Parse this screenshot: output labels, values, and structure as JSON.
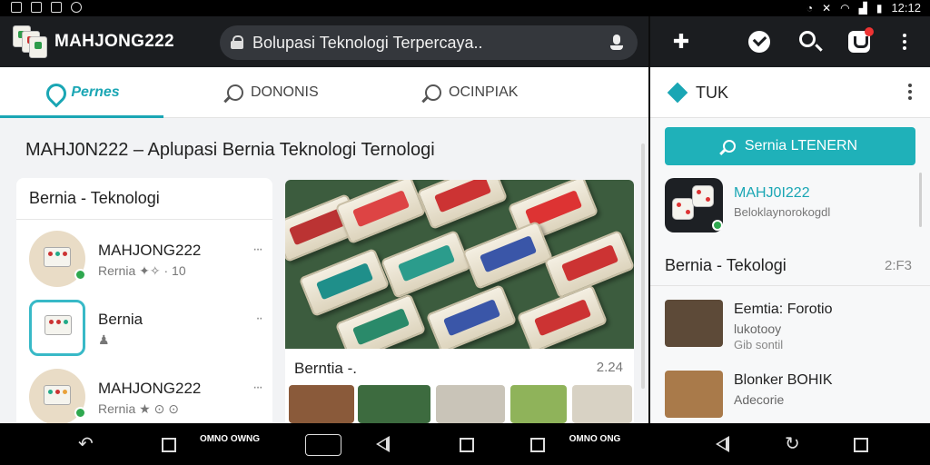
{
  "status_bar": {
    "time": "12:12"
  },
  "browser": {
    "app_name": "MAHJONG222",
    "url_text": "Bolupasi Teknologi Terpercaya.."
  },
  "tabs": [
    {
      "label": "Pernes",
      "active": true
    },
    {
      "label": "DONONIS",
      "active": false
    },
    {
      "label": "OCINPIAK",
      "active": false
    }
  ],
  "page": {
    "heading": "MAHJ0N222 – Aplupasi Bernia Teknologi Ternologi"
  },
  "card": {
    "title": "Bernia - Teknologi",
    "rows": [
      {
        "name": "MAHJONG222",
        "sub": "Rernia  ✦✧ · 10",
        "more": "···"
      },
      {
        "name": "Bernia",
        "sub": "♟",
        "more": "··"
      },
      {
        "name": "MAHJONG222",
        "sub": "Rernia  ★ ⊙ ⊙",
        "more": "···"
      }
    ]
  },
  "feature": {
    "caption": "Berntia -.",
    "count": "2.24"
  },
  "right_panel": {
    "header_title": "TUK",
    "cta_label": "Sernia LTENERN",
    "app": {
      "name": "MAHJ0I222",
      "sub": "Beloklaynorokogdl"
    },
    "section_title": "Bernia - Tekologi",
    "section_count": "2:F3",
    "items": [
      {
        "name": "Eemtia: Forotio",
        "sub1": "lukotooy",
        "sub2": "Gib sontil"
      },
      {
        "name": "Blonker BOHIK",
        "sub1": "Adecorie",
        "sub2": ""
      }
    ]
  },
  "nav_bar": {
    "logos": [
      "OMNO OWNG",
      "OMNO ONG"
    ]
  },
  "colors": {
    "accent": "#1aa6b4",
    "cta": "#1fb1b9",
    "topbar": "#1b1d20",
    "online_badge": "#2fa84f"
  }
}
